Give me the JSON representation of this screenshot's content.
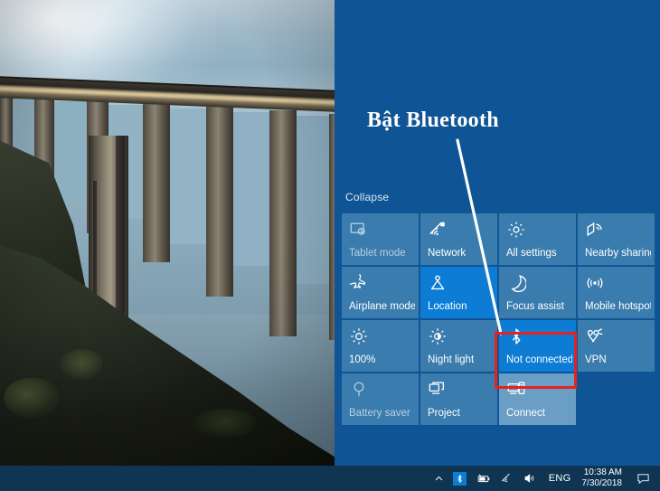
{
  "desktop": {
    "wallpaper_description": "bixby-bridge-coastal-photo"
  },
  "action_center": {
    "collapse_label": "Collapse",
    "colors": {
      "panel_background": "#0f5494",
      "tile_inactive": "#3a7cae",
      "tile_active": "#0c7cd5",
      "tile_hover": "#6b9ec4",
      "highlight_box": "#e8211b",
      "taskbar": "#0f3553"
    },
    "tiles": [
      {
        "label": "Tablet mode",
        "icon": "tablet-mode-icon",
        "state": "disabled"
      },
      {
        "label": "Network",
        "icon": "network-wifi-icon",
        "state": "inactive"
      },
      {
        "label": "All settings",
        "icon": "gear-icon",
        "state": "inactive"
      },
      {
        "label": "Nearby sharing",
        "icon": "nearby-sharing-icon",
        "state": "inactive"
      },
      {
        "label": "Airplane mode",
        "icon": "airplane-icon",
        "state": "inactive"
      },
      {
        "label": "Location",
        "icon": "location-pin-icon",
        "state": "active"
      },
      {
        "label": "Focus assist",
        "icon": "moon-icon",
        "state": "inactive"
      },
      {
        "label": "Mobile hotspot",
        "icon": "hotspot-icon",
        "state": "inactive"
      },
      {
        "label": "100%",
        "icon": "brightness-icon",
        "state": "inactive"
      },
      {
        "label": "Night light",
        "icon": "night-light-icon",
        "state": "inactive"
      },
      {
        "label": "Not connected",
        "icon": "bluetooth-icon",
        "state": "active"
      },
      {
        "label": "VPN",
        "icon": "vpn-icon",
        "state": "inactive"
      },
      {
        "label": "Battery saver",
        "icon": "battery-saver-icon",
        "state": "disabled"
      },
      {
        "label": "Project",
        "icon": "project-icon",
        "state": "inactive"
      },
      {
        "label": "Connect",
        "icon": "connect-icon",
        "state": "hovered"
      }
    ]
  },
  "annotation": {
    "title": "Bật Bluetooth",
    "pointer": "arrow-line-to-bluetooth-tile",
    "highlight_target": "Not connected"
  },
  "taskbar": {
    "show_hidden_icons": "chevron-up-icon",
    "tray_icons": [
      {
        "name": "bluetooth-tray-icon",
        "highlighted": true
      },
      {
        "name": "battery-icon"
      },
      {
        "name": "wifi-icon"
      },
      {
        "name": "volume-icon"
      }
    ],
    "language": "ENG",
    "clock": {
      "time": "10:38 AM",
      "date": "7/30/2018"
    },
    "action_center_icon": "action-center-icon"
  }
}
